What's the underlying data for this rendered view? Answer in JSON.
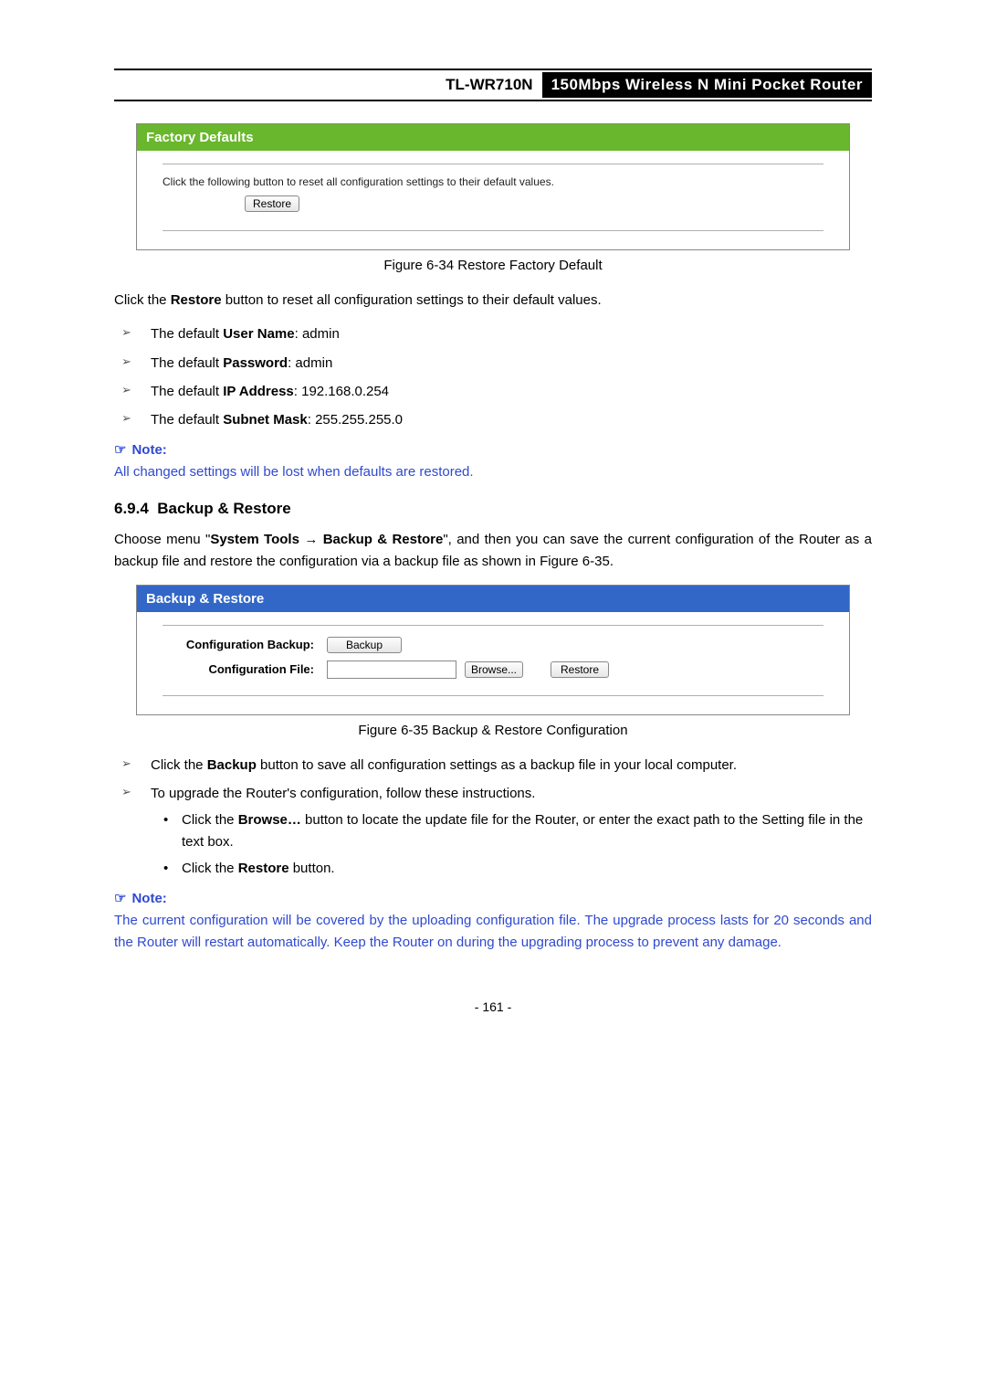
{
  "header": {
    "model": "TL-WR710N",
    "product_line": "150Mbps Wireless N Mini Pocket Router"
  },
  "factory_defaults": {
    "panel_title": "Factory Defaults",
    "instruction": "Click the following button to reset all configuration settings to their default values.",
    "button": "Restore",
    "caption": "Figure 6-34 Restore Factory Default"
  },
  "restore_paragraph": {
    "prefix": "Click the ",
    "bold": "Restore",
    "suffix": " button to reset all configuration settings to their default values."
  },
  "defaults_list": [
    {
      "prefix": "The default ",
      "bold": "User Name",
      "suffix": ": admin"
    },
    {
      "prefix": "The default ",
      "bold": "Password",
      "suffix": ": admin"
    },
    {
      "prefix": "The default ",
      "bold": "IP Address",
      "suffix": ": 192.168.0.254"
    },
    {
      "prefix": "The default ",
      "bold": "Subnet Mask",
      "suffix": ": 255.255.255.0"
    }
  ],
  "note1": {
    "label": "Note:",
    "text": "All changed settings will be lost when defaults are restored."
  },
  "section": {
    "number": "6.9.4",
    "title": "Backup & Restore"
  },
  "section_intro": {
    "a": "Choose menu \"",
    "b": "System Tools",
    "arrow": " → ",
    "c": "Backup & Restore",
    "d": "\", and then you can save the current configuration of the Router as a backup file and restore the configuration via a backup file as shown in Figure 6-35."
  },
  "backup_restore": {
    "panel_title": "Backup & Restore",
    "row1_label": "Configuration Backup:",
    "backup_button": "Backup",
    "row2_label": "Configuration File:",
    "browse_button": "Browse...",
    "restore_button": "Restore",
    "caption": "Figure 6-35   Backup & Restore Configuration"
  },
  "br_list": {
    "i1_pre": "Click the ",
    "i1_bold": "Backup",
    "i1_post": " button to save all configuration settings as a backup file in your local computer.",
    "i2": "To upgrade the Router's configuration, follow these instructions.",
    "sub1_pre": "Click the ",
    "sub1_bold": "Browse…",
    "sub1_post": " button to locate the update file for the Router, or enter the exact path to the Setting file in the text box.",
    "sub2_pre": "Click the ",
    "sub2_bold": "Restore",
    "sub2_post": " button."
  },
  "note2": {
    "label": "Note:",
    "text": "The current configuration will be covered by the uploading configuration file. The upgrade process lasts for 20 seconds and the Router will restart automatically. Keep the Router on during the upgrading process to prevent any damage."
  },
  "page_number": "- 161 -"
}
